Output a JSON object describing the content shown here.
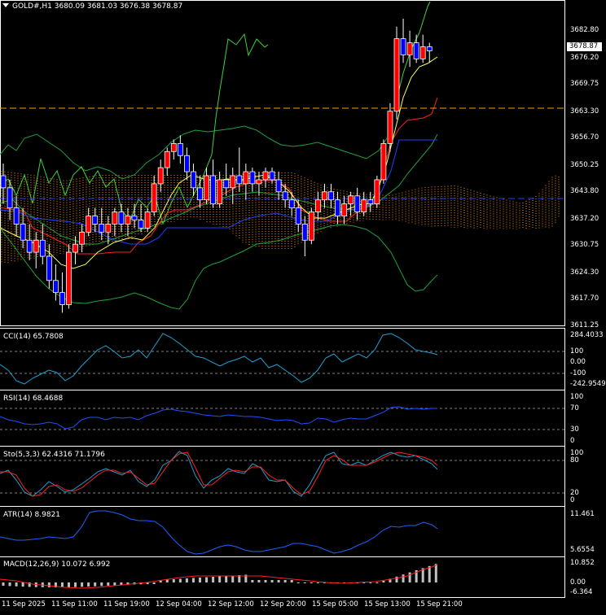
{
  "main_chart": {
    "header": "GOLD#,H1  3680.09 3681.03 3676.38 3678.87",
    "current_price": "3678.87",
    "price_axis": [
      "3682.80",
      "3676.20",
      "3669.75",
      "3663.30",
      "3656.70",
      "3650.25",
      "3643.80",
      "3637.20",
      "3630.75",
      "3624.30",
      "3617.70",
      "3611.25"
    ]
  },
  "indicators": {
    "cci": {
      "label": "CCI(14) 65.7808",
      "axis": [
        "284.4033",
        "100",
        "0.00",
        "-100",
        "-242.9549"
      ]
    },
    "rsi": {
      "label": "RSI(14) 68.4688",
      "axis": [
        "100",
        "70",
        "30",
        "0"
      ]
    },
    "stoch": {
      "label": "Sto(5,3,3) 62.4316 71.1796",
      "axis": [
        "100",
        "80",
        "20",
        "0"
      ]
    },
    "atr": {
      "label": "ATR(14) 8.9821",
      "axis": [
        "11.461",
        "5.6554"
      ]
    },
    "macd": {
      "label": "MACD(12,26,9) 10.072 6.992",
      "axis": [
        "10.852",
        "0.00",
        "-6.364"
      ]
    }
  },
  "time_axis": [
    "11 Sep 2025",
    "11 Sep 11:00",
    "11 Sep 19:00",
    "12 Sep 04:00",
    "12 Sep 12:00",
    "12 Sep 20:00",
    "15 Sep 05:00",
    "15 Sep 13:00",
    "15 Sep 21:00"
  ],
  "colors": {
    "background": "#000000",
    "bull_candle": "#ff0000",
    "bear_candle": "#ffffff",
    "bear_candle_body": "#0000ff",
    "kumo": "#ff9900",
    "indicator_line": "#20a0d0",
    "signal_line": "#ff2020",
    "bands": "#20a040",
    "level_line": "#ff9900"
  },
  "chart_data": {
    "type": "candlestick",
    "ylim": [
      3611.25,
      3690
    ],
    "level_price": 3664.3,
    "ohlc": [
      [
        3648,
        3651,
        3641,
        3645
      ],
      [
        3645,
        3647,
        3637,
        3640
      ],
      [
        3640,
        3643,
        3633,
        3636
      ],
      [
        3636,
        3640,
        3630,
        3632
      ],
      [
        3632,
        3636,
        3627,
        3629
      ],
      [
        3629,
        3634,
        3625,
        3632
      ],
      [
        3632,
        3636,
        3626,
        3628
      ],
      [
        3628,
        3631,
        3620,
        3622
      ],
      [
        3622,
        3626,
        3617,
        3619
      ],
      [
        3619,
        3624,
        3614,
        3616
      ],
      [
        3616,
        3631,
        3615,
        3629
      ],
      [
        3629,
        3633,
        3626,
        3631
      ],
      [
        3631,
        3636,
        3629,
        3634
      ],
      [
        3634,
        3640,
        3633,
        3638
      ],
      [
        3638,
        3640,
        3634,
        3636
      ],
      [
        3636,
        3640,
        3632,
        3634
      ],
      [
        3634,
        3638,
        3631,
        3636
      ],
      [
        3636,
        3640,
        3633,
        3639
      ],
      [
        3639,
        3641,
        3634,
        3636
      ],
      [
        3636,
        3640,
        3633,
        3638
      ],
      [
        3638,
        3641,
        3635,
        3637
      ],
      [
        3637,
        3641,
        3634,
        3635
      ],
      [
        3635,
        3640,
        3634,
        3639
      ],
      [
        3639,
        3648,
        3638,
        3646
      ],
      [
        3646,
        3652,
        3644,
        3650
      ],
      [
        3650,
        3655,
        3648,
        3654
      ],
      [
        3654,
        3657,
        3652,
        3656
      ],
      [
        3656,
        3658,
        3651,
        3653
      ],
      [
        3653,
        3655,
        3647,
        3649
      ],
      [
        3649,
        3651,
        3643,
        3645
      ],
      [
        3645,
        3648,
        3640,
        3642
      ],
      [
        3642,
        3650,
        3641,
        3648
      ],
      [
        3648,
        3652,
        3640,
        3641
      ],
      [
        3641,
        3649,
        3640,
        3647
      ],
      [
        3647,
        3651,
        3643,
        3645
      ],
      [
        3645,
        3650,
        3641,
        3648
      ],
      [
        3648,
        3655,
        3644,
        3646
      ],
      [
        3646,
        3651,
        3642,
        3649
      ],
      [
        3649,
        3650,
        3644,
        3646
      ],
      [
        3646,
        3649,
        3643,
        3647
      ],
      [
        3647,
        3650,
        3645,
        3649
      ],
      [
        3649,
        3650,
        3646,
        3647
      ],
      [
        3647,
        3649,
        3642,
        3644
      ],
      [
        3644,
        3646,
        3640,
        3642
      ],
      [
        3642,
        3644,
        3638,
        3640
      ],
      [
        3640,
        3642,
        3634,
        3636
      ],
      [
        3636,
        3638,
        3628,
        3632
      ],
      [
        3632,
        3640,
        3631,
        3639
      ],
      [
        3639,
        3644,
        3637,
        3642
      ],
      [
        3642,
        3646,
        3640,
        3644
      ],
      [
        3644,
        3646,
        3640,
        3642
      ],
      [
        3642,
        3644,
        3636,
        3638
      ],
      [
        3638,
        3643,
        3636,
        3641
      ],
      [
        3641,
        3644,
        3638,
        3643
      ],
      [
        3643,
        3645,
        3637,
        3639
      ],
      [
        3639,
        3644,
        3638,
        3642
      ],
      [
        3642,
        3644,
        3639,
        3641
      ],
      [
        3641,
        3648,
        3640,
        3647
      ],
      [
        3647,
        3657,
        3646,
        3656
      ],
      [
        3656,
        3666,
        3654,
        3664
      ],
      [
        3664,
        3685,
        3662,
        3682
      ],
      [
        3682,
        3687,
        3676,
        3678
      ],
      [
        3678,
        3684,
        3675,
        3681
      ],
      [
        3681,
        3683,
        3676,
        3677
      ],
      [
        3677,
        3683,
        3676,
        3680
      ],
      [
        3680,
        3681,
        3676,
        3679
      ]
    ]
  }
}
